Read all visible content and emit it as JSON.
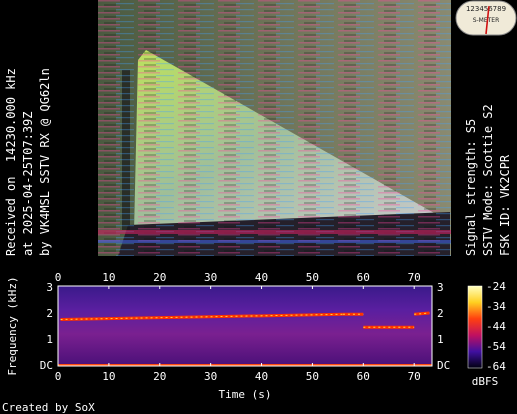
{
  "left_caption": {
    "line1": "Received on  14230.000 kHz",
    "line2": "at 2025-04-25T07:39Z",
    "line3": "by VK4MSL SSTV RX @ QG62ln"
  },
  "right_caption": {
    "line1": "Signal strength: S5",
    "line2": "SSTV Mode: Scottie S2",
    "line3": "FSK ID: VK2CPR"
  },
  "meter": {
    "scale_text": "123456789",
    "label": "S-METER",
    "level_fraction": 0.55
  },
  "spectrogram": {
    "time_ticks": [
      "0",
      "10",
      "20",
      "30",
      "40",
      "50",
      "60",
      "70"
    ],
    "freq_ticks": [
      "DC",
      "1",
      "2",
      "3"
    ],
    "ylabel": "Frequency (kHz)",
    "xlabel": "Time (s)",
    "colorbar_ticks": [
      "-24",
      "-34",
      "-44",
      "-54",
      "-64"
    ],
    "colorbar_unit": "dBFS",
    "credit": "Created by SoX"
  },
  "colors": {
    "background": "#000000",
    "text": "#ffffff",
    "trace": "#ff3300",
    "noise": "#5a1fa0"
  }
}
